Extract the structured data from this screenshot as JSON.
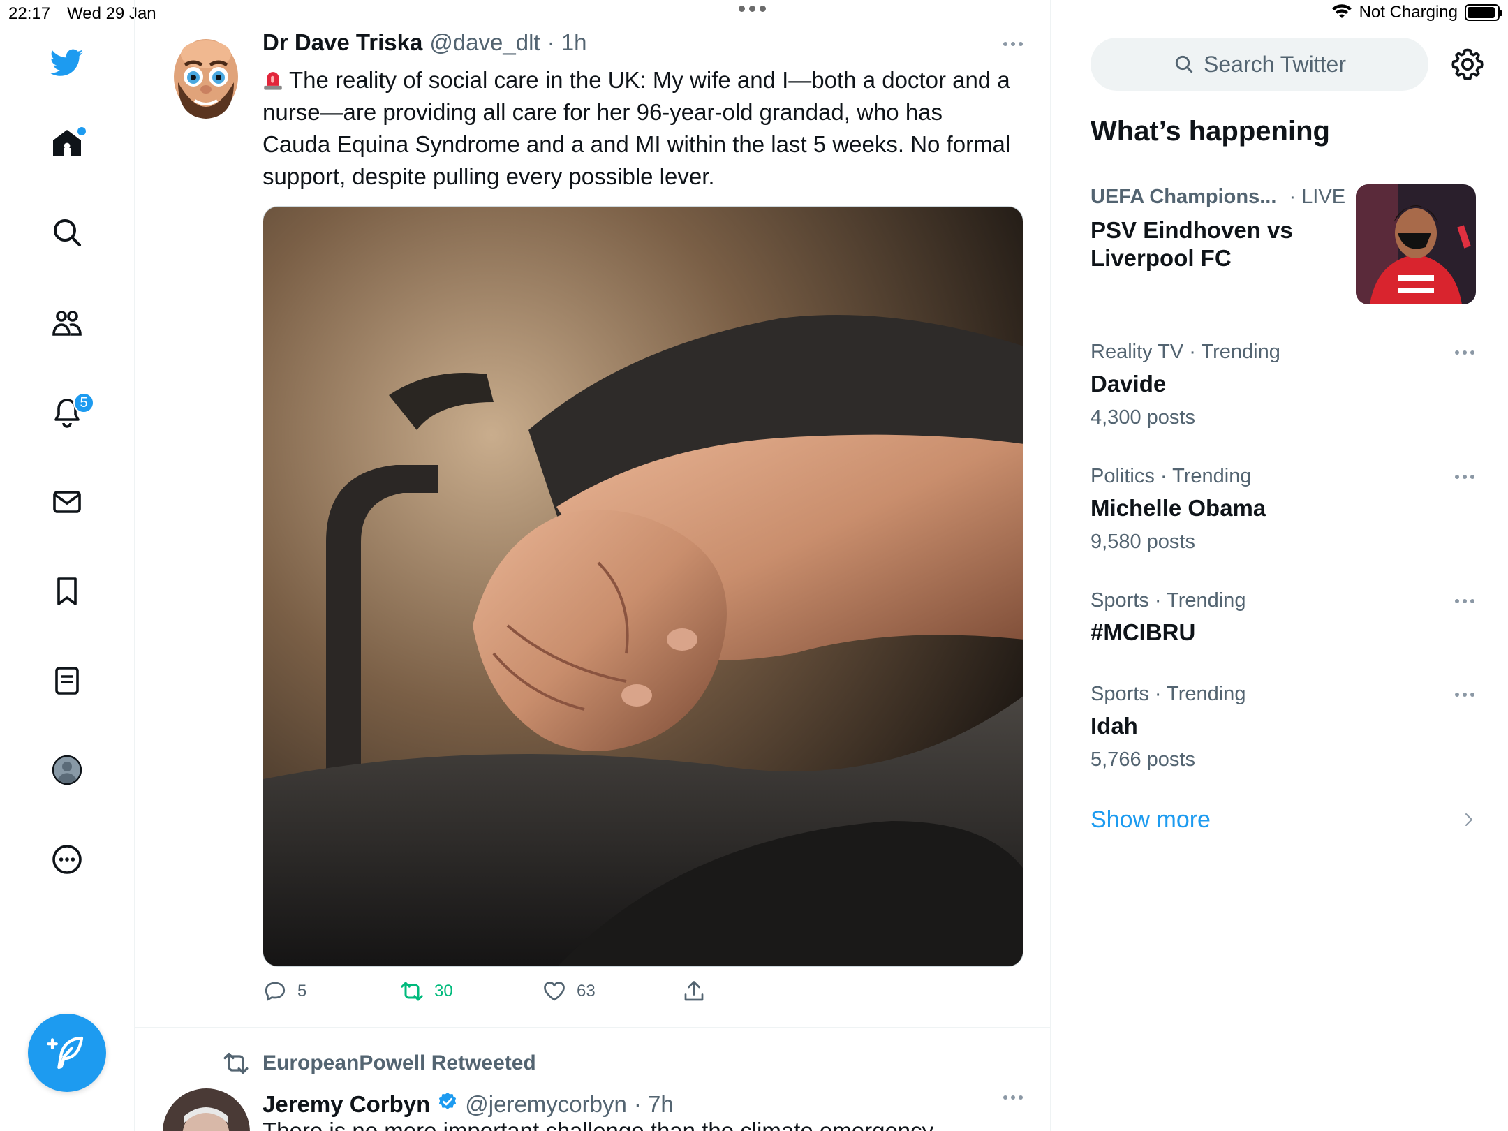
{
  "status_bar": {
    "time": "22:17",
    "date": "Wed 29 Jan",
    "charging": "Not Charging"
  },
  "nav": {
    "items": [
      {
        "name": "twitter-logo-icon"
      },
      {
        "name": "home-icon"
      },
      {
        "name": "explore-icon"
      },
      {
        "name": "communities-icon"
      },
      {
        "name": "notifications-icon",
        "badge": "5"
      },
      {
        "name": "messages-icon"
      },
      {
        "name": "bookmarks-icon"
      },
      {
        "name": "lists-icon"
      },
      {
        "name": "profile-icon"
      },
      {
        "name": "more-icon"
      }
    ],
    "compose_icon": "compose-feather-icon"
  },
  "tweets": [
    {
      "name": "Dr Dave Triska",
      "handle": "@dave_dlt",
      "time": "· 1h",
      "emoji": "rotating-light-icon",
      "text": "The reality of social care in the UK: My wife and I—both a doctor and a nurse—are providing all care for her 96-year-old grandad, who has Cauda Equina Syndrome and a and MI within the last 5 weeks. No formal support, despite pulling every possible lever.",
      "replies": "5",
      "retweets": "30",
      "likes": "63"
    },
    {
      "retweeted_by": "EuropeanPowell Retweeted",
      "name": "Jeremy Corbyn",
      "handle": "@jeremycorbyn",
      "time": "· 7h",
      "text": "There is no more important challenge than the climate emergency"
    }
  ],
  "right": {
    "search_placeholder": "Search Twitter",
    "section_title": "What’s happening",
    "featured": {
      "category": "UEFA Champions...",
      "status": "· LIVE",
      "title": "PSV Eindhoven vs Liverpool FC"
    },
    "trends": [
      {
        "category": "Reality TV · Trending",
        "name": "Davide",
        "count": "4,300 posts"
      },
      {
        "category": "Politics · Trending",
        "name": "Michelle Obama",
        "count": "9,580 posts"
      },
      {
        "category": "Sports · Trending",
        "name": "#MCIBRU",
        "count": ""
      },
      {
        "category": "Sports · Trending",
        "name": "Idah",
        "count": "5,766 posts"
      }
    ],
    "show_more": "Show more"
  },
  "colors": {
    "accent": "#1d9bf0",
    "retweet": "#00ba7c",
    "secondary_text": "#536471"
  }
}
